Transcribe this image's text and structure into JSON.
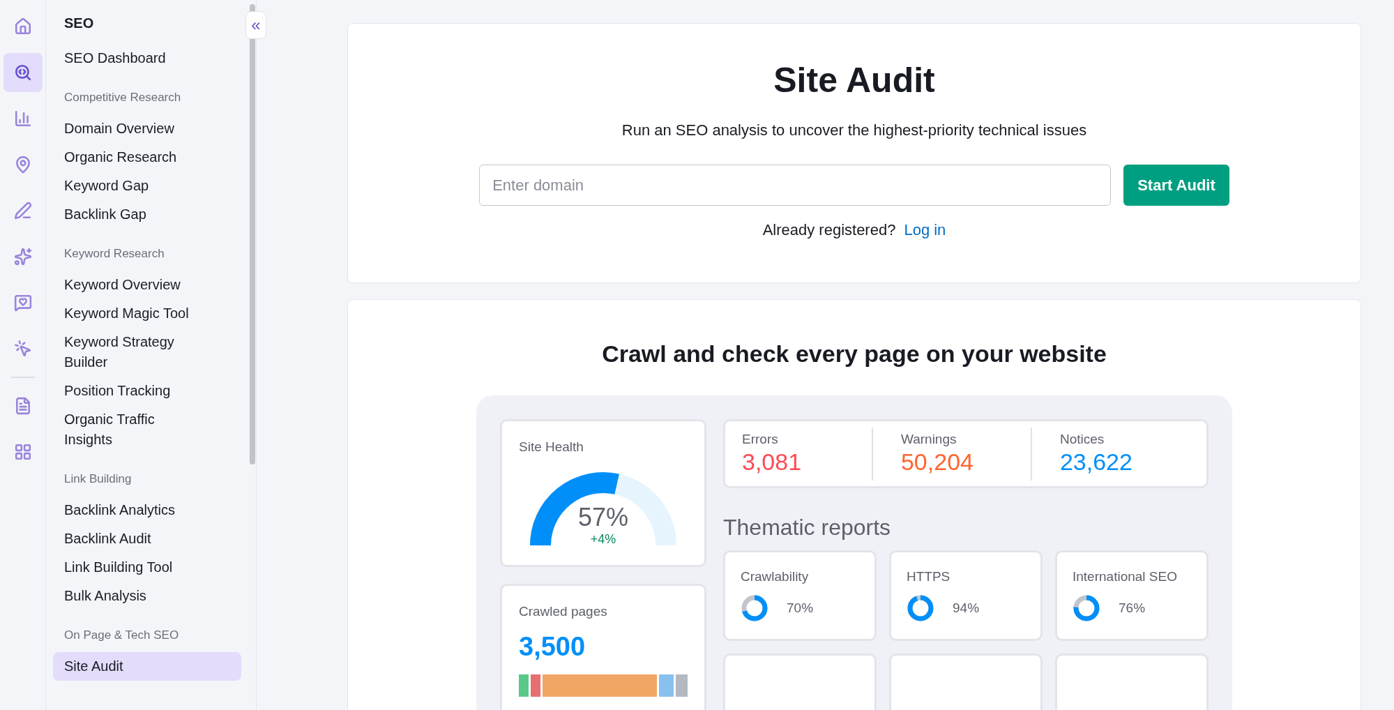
{
  "icon_rail": [
    {
      "kind": "home",
      "selected": false
    },
    {
      "kind": "seo",
      "selected": true
    },
    {
      "kind": "chart",
      "selected": false
    },
    {
      "kind": "pin",
      "selected": false
    },
    {
      "kind": "pen",
      "selected": false
    },
    {
      "kind": "sparkle",
      "selected": false
    },
    {
      "kind": "heart",
      "selected": false
    },
    {
      "kind": "cursor",
      "selected": false
    }
  ],
  "icon_rail_bottom": [
    {
      "kind": "document",
      "selected": false
    },
    {
      "kind": "apps",
      "selected": false
    }
  ],
  "sidebar": {
    "title": "SEO",
    "top_items": [
      {
        "label": "SEO Dashboard",
        "selected": false
      }
    ],
    "groups": [
      {
        "heading": "Competitive Research",
        "items": [
          {
            "label": "Domain Overview",
            "selected": false
          },
          {
            "label": "Organic Research",
            "selected": false
          },
          {
            "label": "Keyword Gap",
            "selected": false
          },
          {
            "label": "Backlink Gap",
            "selected": false
          }
        ]
      },
      {
        "heading": "Keyword Research",
        "items": [
          {
            "label": "Keyword Overview",
            "selected": false
          },
          {
            "label": "Keyword Magic Tool",
            "selected": false
          },
          {
            "label": "Keyword Strategy Builder",
            "selected": false
          },
          {
            "label": "Position Tracking",
            "selected": false
          },
          {
            "label": "Organic Traffic Insights",
            "selected": false
          }
        ]
      },
      {
        "heading": "Link Building",
        "items": [
          {
            "label": "Backlink Analytics",
            "selected": false
          },
          {
            "label": "Backlink Audit",
            "selected": false
          },
          {
            "label": "Link Building Tool",
            "selected": false
          },
          {
            "label": "Bulk Analysis",
            "selected": false
          }
        ]
      },
      {
        "heading": "On Page & Tech SEO",
        "items": [
          {
            "label": "Site Audit",
            "selected": true
          }
        ]
      }
    ],
    "collapse_button": "«"
  },
  "audit_card": {
    "title": "Site Audit",
    "subtitle": "Run an SEO analysis to uncover the highest-priority technical issues",
    "domain_field": {
      "placeholder": "Enter domain"
    },
    "button": "Start Audit",
    "login_prompt": "Already registered?",
    "login_link": "Log in"
  },
  "promo_card": {
    "heading": "Crawl and check every page on your website",
    "site_health": {
      "label": "Site Health",
      "value": "57%",
      "change": "+4%",
      "level": 0.57
    },
    "crawled_pages": {
      "label": "Crawled pages",
      "value": "3,500",
      "segments": [
        {
          "color": "#59c98a"
        },
        {
          "color": "#e86f6f"
        },
        {
          "color": "#f2a664"
        },
        {
          "color": "#88c0ee"
        },
        {
          "color": "#b4b8c2"
        }
      ]
    },
    "issues": [
      {
        "label": "Errors",
        "value": "3,081",
        "color": "#ff4953"
      },
      {
        "label": "Warnings",
        "value": "50,204",
        "color": "#ff642d"
      },
      {
        "label": "Notices",
        "value": "23,622",
        "color": "#008ff8"
      }
    ],
    "thematic_heading": "Thematic reports",
    "reports": [
      {
        "name": "Crawlability",
        "value": "70%",
        "level": 0.7
      },
      {
        "name": "HTTPS",
        "value": "94%",
        "level": 0.94
      },
      {
        "name": "International SEO",
        "value": "76%",
        "level": 0.76
      }
    ]
  }
}
